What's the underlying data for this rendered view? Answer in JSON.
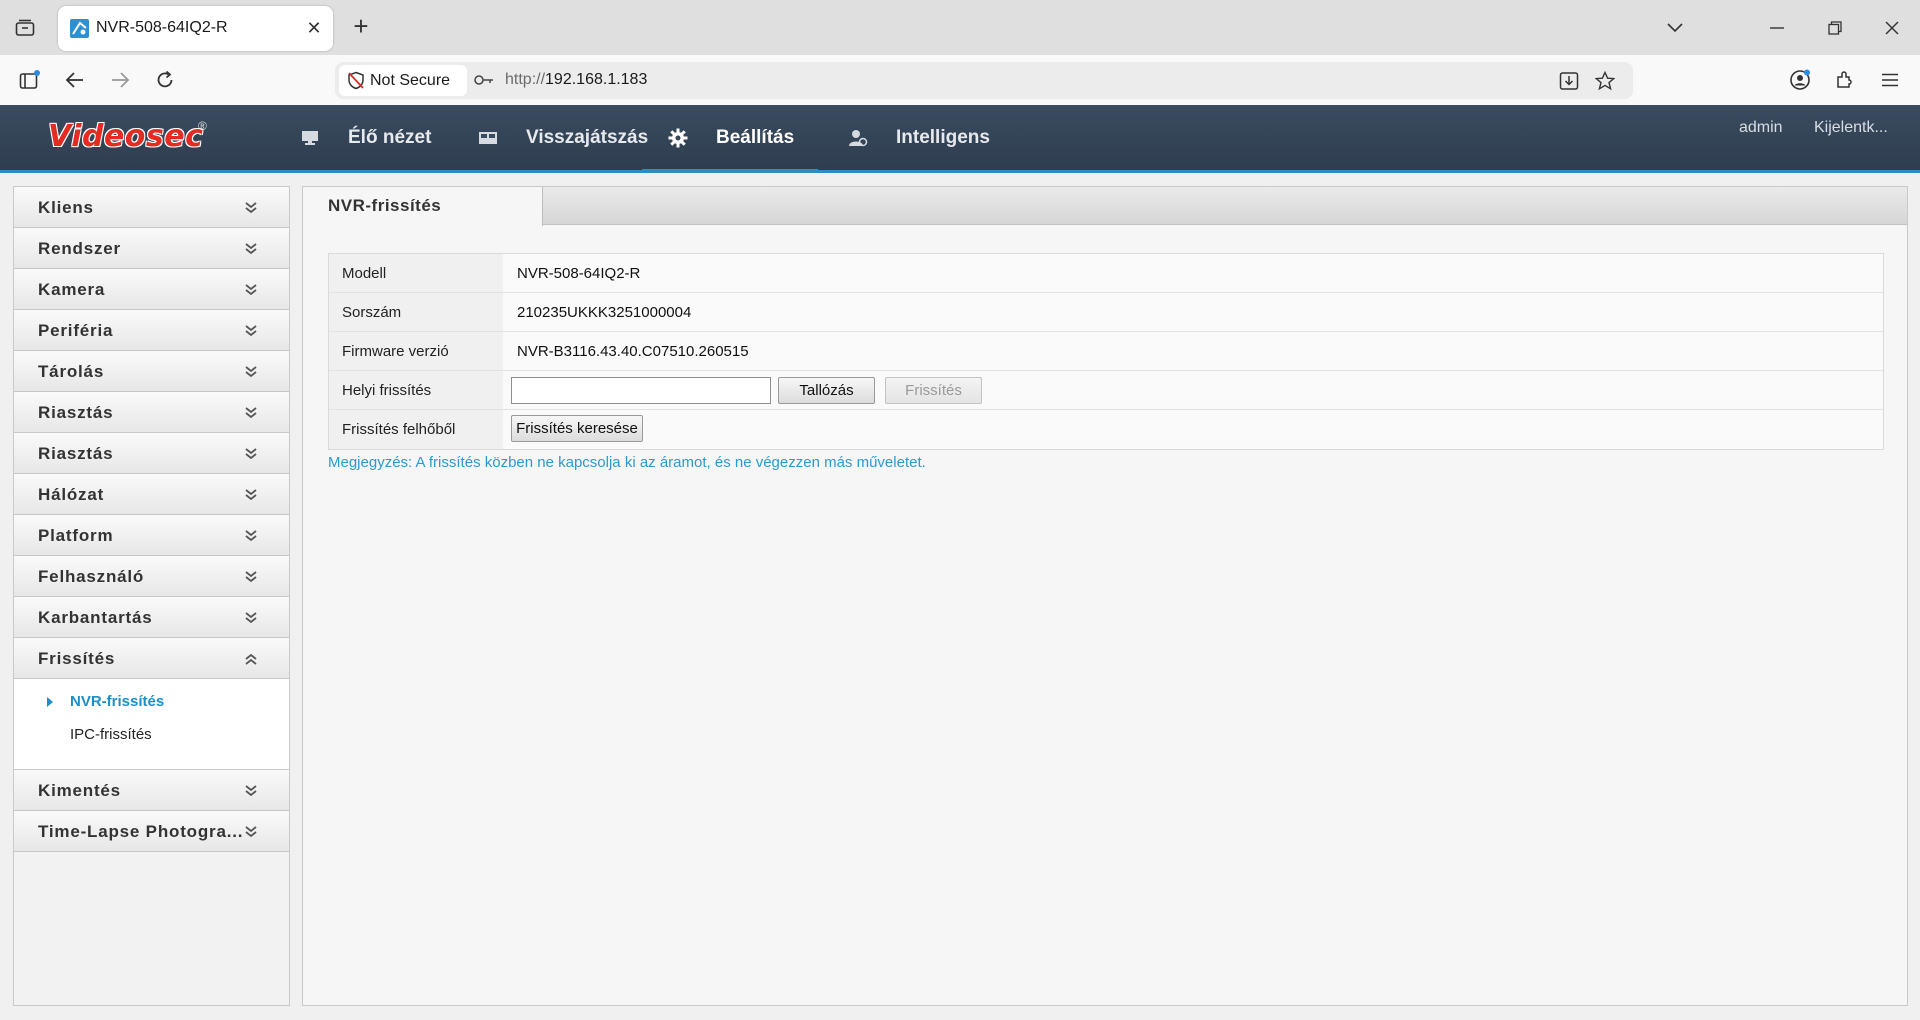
{
  "browser": {
    "tab_title": "NVR-508-64IQ2-R",
    "not_secure_label": "Not Secure",
    "url_scheme": "http://",
    "url_host": "192.168.1.183"
  },
  "header": {
    "logo_text": "Videosec",
    "logo_reg": "®",
    "nav": [
      {
        "label": "Élő nézet",
        "icon": "monitor-icon"
      },
      {
        "label": "Visszajátszás",
        "icon": "playback-icon"
      },
      {
        "label": "Beállítás",
        "icon": "gear-icon",
        "active": true
      },
      {
        "label": "Intelligens",
        "icon": "person-icon"
      }
    ],
    "user": "admin",
    "logout": "Kijelentk..."
  },
  "sidebar": {
    "items": [
      {
        "label": "Kliens"
      },
      {
        "label": "Rendszer"
      },
      {
        "label": "Kamera"
      },
      {
        "label": "Periféria"
      },
      {
        "label": "Tárolás"
      },
      {
        "label": "Riasztás"
      },
      {
        "label": "Riasztás"
      },
      {
        "label": "Hálózat"
      },
      {
        "label": "Platform"
      },
      {
        "label": "Felhasználó"
      },
      {
        "label": "Karbantartás"
      },
      {
        "label": "Frissítés",
        "expanded": true
      },
      {
        "label": "Kimentés"
      },
      {
        "label": "Time-Lapse Photogra..."
      }
    ],
    "sub_items": [
      {
        "label": "NVR-frissítés",
        "active": true
      },
      {
        "label": "IPC-frissítés"
      }
    ]
  },
  "content": {
    "tab_label": "NVR-frissítés",
    "rows": {
      "model_label": "Modell",
      "model_value": "NVR-508-64IQ2-R",
      "serial_label": "Sorszám",
      "serial_value": "210235UKKK3251000004",
      "firmware_label": "Firmware verzió",
      "firmware_value": "NVR-B3116.43.40.C07510.260515",
      "local_label": "Helyi frissítés",
      "browse_button": "Tallózás",
      "upgrade_button": "Frissítés",
      "cloud_label": "Frissítés felhőből",
      "check_button": "Frissítés keresése"
    },
    "note": "Megjegyzés: A frissítés közben ne kapcsolja ki az áramot, és ne végezzen más műveletet."
  },
  "colors": {
    "header_bg": "#34455a",
    "accent": "#2b8dc4",
    "logo_red": "#e42b22",
    "note_blue": "#2a9bd0"
  }
}
